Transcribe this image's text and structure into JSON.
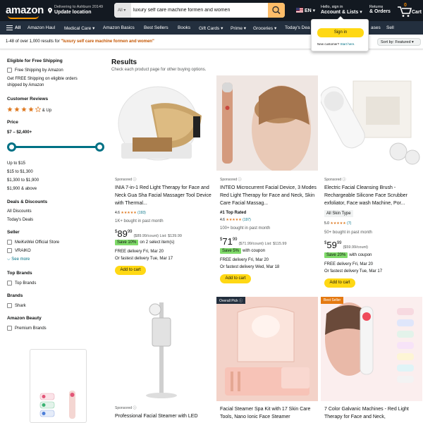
{
  "header": {
    "logo": "amazon",
    "deliver_line1": "Delivering to Ashburn 20149",
    "deliver_line2": "Update location",
    "search_category": "All",
    "search_value": "luxury self care machine formen and women",
    "lang": "EN",
    "account_line1": "Hello, sign in",
    "account_line2": "Account & Lists",
    "returns_line1": "Returns",
    "returns_line2": "& Orders",
    "cart_count": "0",
    "cart_label": "Cart"
  },
  "subnav": {
    "all": "All",
    "items": [
      "Amazon Haul",
      "Medical Care",
      "Amazon Basics",
      "Best Sellers",
      "Books",
      "Gift Cards",
      "Prime",
      "Groceries",
      "Today's Dea",
      "ases",
      "Sell"
    ]
  },
  "flyout": {
    "sign_in": "Sign in",
    "new_customer": "New customer?",
    "start_here": "Start here."
  },
  "results_bar": {
    "prefix": "1-48 of over 1,000 results for",
    "query": "\"luxury self care machine formen and women\"",
    "sort_label": "Sort by:",
    "sort_value": "Featured"
  },
  "sidebar": {
    "free_shipping_h": "Eligible for Free Shipping",
    "free_shipping_cb": "Free Shipping by Amazon",
    "free_shipping_note1": "Get FREE Shipping on eligible orders",
    "free_shipping_note2": "shipped by Amazon",
    "reviews_h": "Customer Reviews",
    "reviews_up": "& Up",
    "price_h": "Price",
    "price_range": "$7 – $2,400+",
    "price_options": [
      "Up to $15",
      "$15 to $1,300",
      "$1,300 to $1,900",
      "$1,900 & above"
    ],
    "deals_h": "Deals & Discounts",
    "deals": [
      "All Discounts",
      "Today's Deals"
    ],
    "seller_h": "Seller",
    "sellers": [
      "MeiKeWei Official Store",
      "VRAIKO"
    ],
    "see_more": "See more",
    "top_brands_h": "Top Brands",
    "top_brands_cb": "Top Brands",
    "brands_h": "Brands",
    "brands_cb": "Shark",
    "amazon_beauty_h": "Amazon Beauty",
    "premium_cb": "Premium Brands"
  },
  "results": {
    "heading": "Results",
    "subheading": "Check each product page for other buying options.",
    "sponsored": "Sponsored",
    "add_to_cart": "Add to cart",
    "products": [
      {
        "title": "INIA 7-in-1 Red Light Therapy for Face and Neck Gua Sha Facial Massager Tool Device with Thermal...",
        "rating": "4.6",
        "reviews": "(193)",
        "bought": "1K+ bought in past month",
        "price_whole": "89",
        "price_frac": "99",
        "unit_list": "($89.99/count) List: $139.99",
        "save_badge": "Save 10%",
        "save_note": "on 2 select item(s)",
        "delivery": "FREE delivery Fri, Mar 20",
        "fastest": "Or fastest delivery Tue, Mar 17"
      },
      {
        "title": "INTEO Microcurrent Facial Device, 3 Modes Red Light Therapy for Face and Neck, Skin Care Facial Massag...",
        "top_rated": "#1 Top Rated",
        "rating": "4.6",
        "reviews": "(197)",
        "bought": "100+ bought in past month",
        "price_whole": "71",
        "price_frac": "99",
        "unit_list": "($71.99/count) List: $115.99",
        "save_badge": "Save 5%",
        "save_note": "with coupon",
        "delivery": "FREE delivery Fri, Mar 20",
        "fastest": "Or fastest delivery Wed, Mar 18"
      },
      {
        "title": "Electric Facial Cleansing Brush - Rechargeable Silicone Face Scrubber exfoliator, Face wash Machine, Por...",
        "chip": "All Skin Type",
        "rating": "5.0",
        "reviews": "(7)",
        "bought": "50+ bought in past month",
        "price_whole": "59",
        "price_frac": "99",
        "unit_list": "($59.99/count)",
        "save_badge": "Save 20%",
        "save_note": "with coupon",
        "delivery": "FREE delivery Fri, Mar 20",
        "fastest": "Or fastest delivery Tue, Mar 17"
      },
      {
        "title": "Professional Facial Steamer with LED"
      },
      {
        "tag": "Overall Pick",
        "title": "Facial Steamer Spa Kit with 17 Skin Care Tools, Nano Ionic Face Steamer"
      },
      {
        "tag": "Best Seller",
        "title": "7 Color Galvanic Machines - Red Light Therapy for Face and Neck,"
      }
    ]
  },
  "colors": {
    "nav_bg": "#131921",
    "subnav_bg": "#232f3e",
    "accent": "#ff9900",
    "search_button": "#febd69",
    "cart_button": "#ffd814",
    "link": "#007185",
    "save_badge": "#7fda69",
    "best_seller": "#e47911"
  }
}
